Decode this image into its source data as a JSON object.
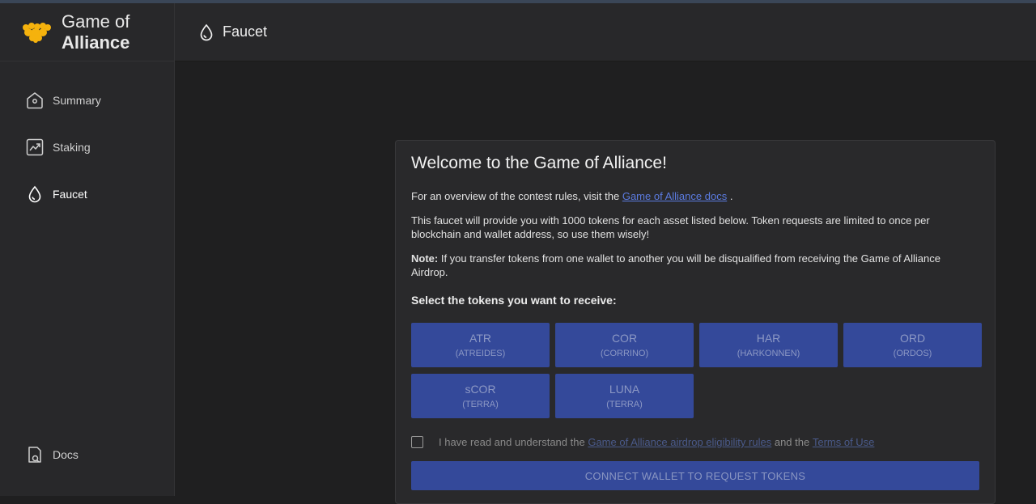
{
  "brand": {
    "line1": "Game of",
    "line2": "Alliance",
    "logo_icon": "golden-handshake-logo",
    "logo_color": "#f5b20d"
  },
  "sidebar": {
    "items": [
      {
        "label": "Summary",
        "icon": "home-icon"
      },
      {
        "label": "Staking",
        "icon": "chart-icon"
      },
      {
        "label": "Faucet",
        "icon": "drop-icon"
      }
    ],
    "docs": {
      "label": "Docs",
      "icon": "docs-icon"
    }
  },
  "header": {
    "title": "Faucet",
    "icon": "drop-icon"
  },
  "card": {
    "title": "Welcome to the Game of Alliance!",
    "overview_prefix": "For an overview of the contest rules, visit the ",
    "overview_link": "Game of Alliance docs",
    "overview_suffix": " .",
    "faucet_text": "This faucet will provide you with 1000 tokens for each asset listed below. Token requests are limited to once per blockchain and wallet address, so use them wisely!",
    "note_label": "Note:",
    "note_text": " If you transfer tokens from one wallet to another you will be disqualified from receiving the Game of Alliance Airdrop.",
    "select_label": "Select the tokens you want to receive:",
    "tokens": [
      {
        "symbol": "ATR",
        "name": "(ATREIDES)"
      },
      {
        "symbol": "COR",
        "name": "(CORRINO)"
      },
      {
        "symbol": "HAR",
        "name": "(HARKONNEN)"
      },
      {
        "symbol": "ORD",
        "name": "(ORDOS)"
      },
      {
        "symbol": "sCOR",
        "name": "(TERRA)"
      },
      {
        "symbol": "LUNA",
        "name": "(TERRA)"
      }
    ],
    "agree_prefix": "I have read and understand the ",
    "agree_link1": "Game of Alliance airdrop eligibility rules",
    "agree_mid": " and the ",
    "agree_link2": "Terms of Use",
    "connect_label": "CONNECT WALLET TO REQUEST TOKENS"
  },
  "colors": {
    "accent": "#34499a",
    "link": "#5b7be0",
    "background": "#1f1f20",
    "panel": "#28282a"
  }
}
